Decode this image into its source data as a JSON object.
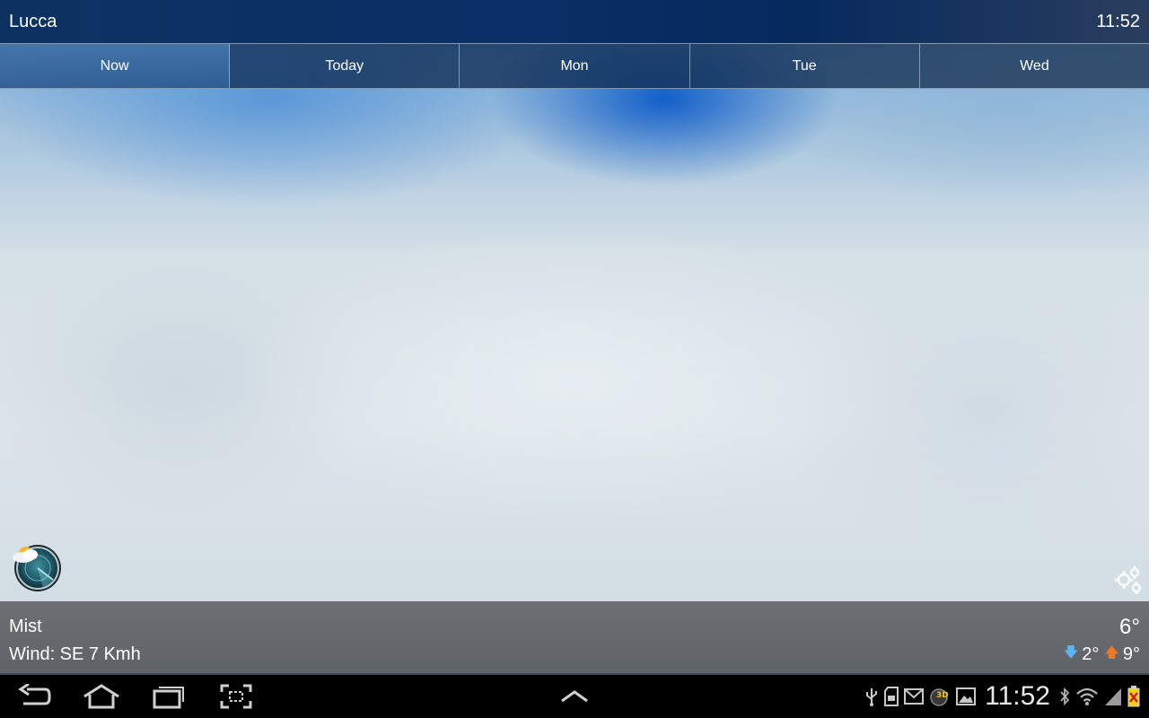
{
  "header": {
    "city": "Lucca",
    "time": "11:52"
  },
  "tabs": [
    {
      "label": "Now",
      "active": true
    },
    {
      "label": "Today",
      "active": false
    },
    {
      "label": "Mon",
      "active": false
    },
    {
      "label": "Tue",
      "active": false
    },
    {
      "label": "Wed",
      "active": false
    }
  ],
  "weather": {
    "condition": "Mist",
    "wind": "Wind: SE 7 Kmh",
    "temperature": "6°",
    "min": "2°",
    "max": "9°"
  },
  "system_bar": {
    "time": "11:52",
    "nav_icons": [
      "back-icon",
      "home-icon",
      "recent-apps-icon",
      "screenshot-icon",
      "chevron-up-icon"
    ],
    "status_icons": [
      "usb-icon",
      "sd-card-icon",
      "gmail-icon",
      "3d-app-icon",
      "gallery-icon",
      "bluetooth-icon",
      "wifi-icon",
      "signal-icon",
      "battery-icon"
    ]
  },
  "colors": {
    "title_bar": "#0b2f66",
    "info_panel": "#64686d",
    "min_arrow": "#5db4f0",
    "max_arrow": "#f07828",
    "battery_fill": "#f5d020"
  }
}
